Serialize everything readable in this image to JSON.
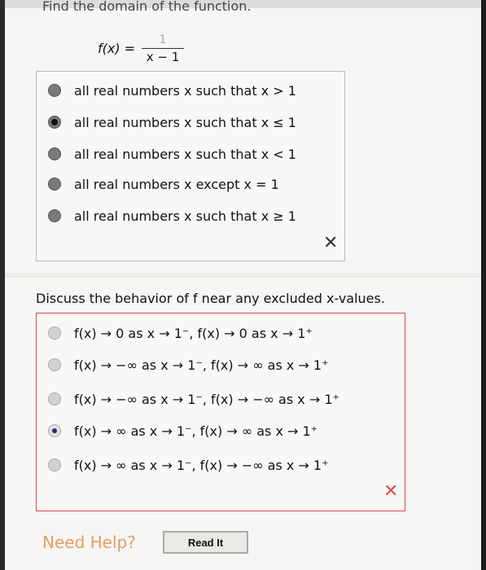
{
  "question_header": "Find the domain of the function.",
  "function": {
    "lhs": "f(x) =",
    "numerator": "1",
    "denominator": "x − 1"
  },
  "part1": {
    "options": [
      {
        "label": "all real numbers x such that x > 1",
        "selected": false
      },
      {
        "label": "all real numbers x such that x ≤ 1",
        "selected": true
      },
      {
        "label": "all real numbers x such that x < 1",
        "selected": false
      },
      {
        "label": "all real numbers x except x = 1",
        "selected": false
      },
      {
        "label": "all real numbers x such that x ≥ 1",
        "selected": false
      }
    ],
    "result_mark": "✕",
    "result_color": "#333333"
  },
  "part2": {
    "prompt": "Discuss the behavior of f near any excluded x-values.",
    "options": [
      {
        "label": "f(x) → 0 as x → 1⁻, f(x) → 0 as x → 1⁺",
        "selected": false
      },
      {
        "label": "f(x) → −∞ as x → 1⁻, f(x) → ∞ as x → 1⁺",
        "selected": false
      },
      {
        "label": "f(x) → −∞ as x → 1⁻, f(x) → −∞ as x → 1⁺",
        "selected": false
      },
      {
        "label": "f(x) → ∞ as x → 1⁻, f(x) → ∞ as x → 1⁺",
        "selected": true
      },
      {
        "label": "f(x) → ∞ as x → 1⁻, f(x) → −∞ as x → 1⁺",
        "selected": false
      }
    ],
    "result_mark": "✕",
    "result_color": "#e04a4a"
  },
  "footer": {
    "need_help": "Need Help?",
    "read_it": "Read It",
    "need_help_color": "#e08a3c"
  }
}
